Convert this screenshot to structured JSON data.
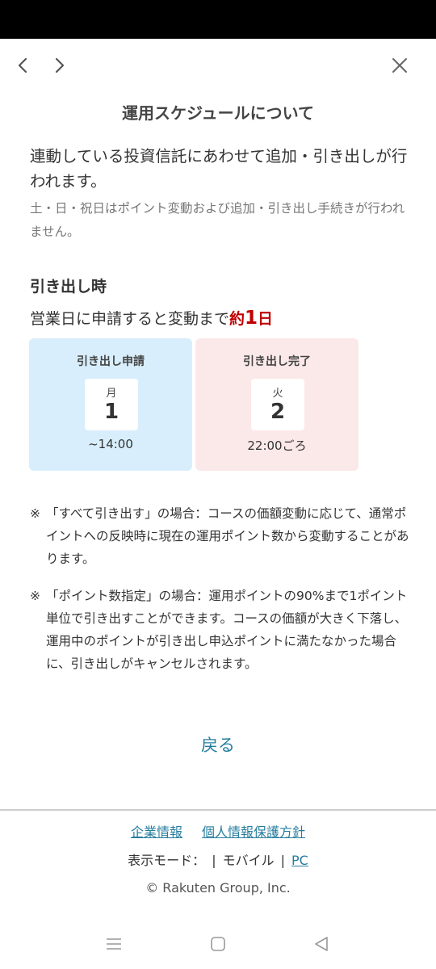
{
  "title": "運用スケジュールについて",
  "lead": "連動している投資信託にあわせて追加・引き出しが行われます。",
  "sub_note": "土・日・祝日はポイント変動および追加・引き出し手続きが行われません。",
  "section": {
    "heading": "引き出し時",
    "desc_prefix": "営業日に申請すると変動まで",
    "desc_hl_pre": "約",
    "desc_hl_num": "1",
    "desc_hl_post": "日"
  },
  "cards": [
    {
      "label": "引き出し申請",
      "day_name": "月",
      "day_num": "1",
      "time": "~14:00"
    },
    {
      "label": "引き出し完了",
      "day_name": "火",
      "day_num": "2",
      "time": "22:00ごろ"
    }
  ],
  "notes": [
    {
      "mark": "※",
      "text": "「すべて引き出す」の場合：コースの価額変動に応じて、通常ポイントへの反映時に現在の運用ポイント数から変動することがあります。"
    },
    {
      "mark": "※",
      "text": "「ポイント数指定」の場合：運用ポイントの90%まで1ポイント単位で引き出すことができます。コースの価額が大きく下落し、運用中のポイントが引き出し申込ポイントに満たなかった場合に、引き出しがキャンセルされます。"
    }
  ],
  "return_label": "戻る",
  "footer": {
    "company_info": "企業情報",
    "privacy_policy": "個人情報保護方針",
    "display_mode_label": "表示モード：",
    "sep": "|",
    "mobile": "モバイル",
    "pc": "PC",
    "copyright": "© Rakuten Group, Inc."
  },
  "icons": {
    "back": "chevron-left-icon",
    "forward": "chevron-right-icon",
    "close": "close-icon",
    "sys_menu": "menu-lines-icon",
    "sys_home": "home-square-icon",
    "sys_back": "triangle-back-icon"
  },
  "colors": {
    "accent_link": "#267d9e",
    "highlight_red": "#bf0000",
    "card_apply_bg": "#d8eefc",
    "card_done_bg": "#fbe8e8"
  }
}
